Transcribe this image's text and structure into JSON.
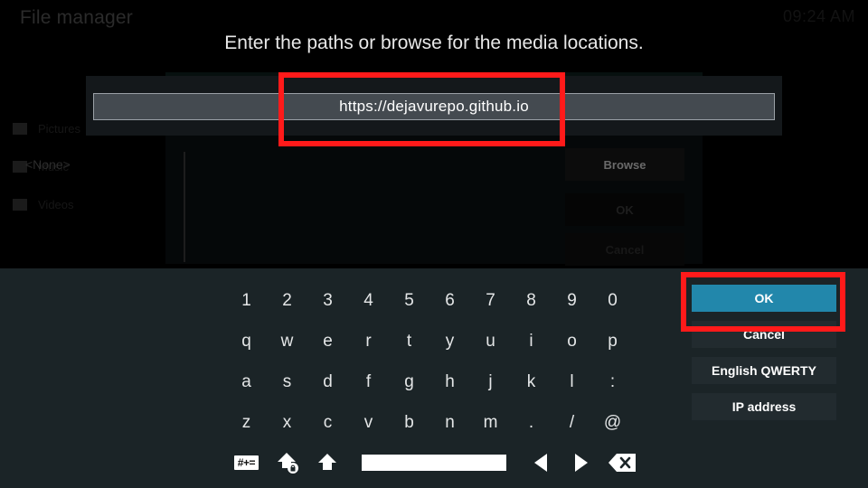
{
  "window": {
    "title": "File manager",
    "clock": "09:24 AM"
  },
  "background": {
    "sidebar_items": [
      {
        "label": "Pictures"
      },
      {
        "label": "Music"
      },
      {
        "label": "Videos"
      }
    ],
    "list_placeholder": "<None>",
    "buttons": [
      {
        "label": "Browse",
        "name": "browse-button"
      },
      {
        "label": "OK",
        "name": "ok-button-bg"
      },
      {
        "label": "Cancel",
        "name": "cancel-button-bg"
      }
    ]
  },
  "dialog": {
    "prompt": "Enter the paths or browse for the media locations.",
    "input": {
      "value": "https://dejavurepo.github.io",
      "placeholder": ""
    }
  },
  "keyboard": {
    "rows": [
      [
        "1",
        "2",
        "3",
        "4",
        "5",
        "6",
        "7",
        "8",
        "9",
        "0"
      ],
      [
        "q",
        "w",
        "e",
        "r",
        "t",
        "y",
        "u",
        "i",
        "o",
        "p"
      ],
      [
        "a",
        "s",
        "d",
        "f",
        "g",
        "h",
        "j",
        "k",
        "l",
        ":"
      ],
      [
        "z",
        "x",
        "c",
        "v",
        "b",
        "n",
        "m",
        ".",
        "/",
        "@"
      ]
    ],
    "bottom_row": [
      {
        "name": "symbols-key",
        "label": "#+="
      },
      {
        "name": "caps-lock-icon",
        "label": ""
      },
      {
        "name": "shift-icon",
        "label": ""
      },
      {
        "name": "spacebar-key",
        "label": ""
      },
      {
        "name": "cursor-left-icon",
        "label": ""
      },
      {
        "name": "cursor-right-icon",
        "label": ""
      },
      {
        "name": "backspace-icon",
        "label": ""
      }
    ]
  },
  "actions": [
    {
      "label": "OK",
      "name": "ok-button",
      "selected": true
    },
    {
      "label": "Cancel",
      "name": "cancel-button",
      "selected": false
    },
    {
      "label": "English QWERTY",
      "name": "layout-button",
      "selected": false
    },
    {
      "label": "IP address",
      "name": "ip-address-button",
      "selected": false
    }
  ],
  "colors": {
    "accent": "#2287ab",
    "annotation": "#ff1a1a",
    "keyboard_bg": "#1b2427",
    "input_bg": "#444a50"
  }
}
